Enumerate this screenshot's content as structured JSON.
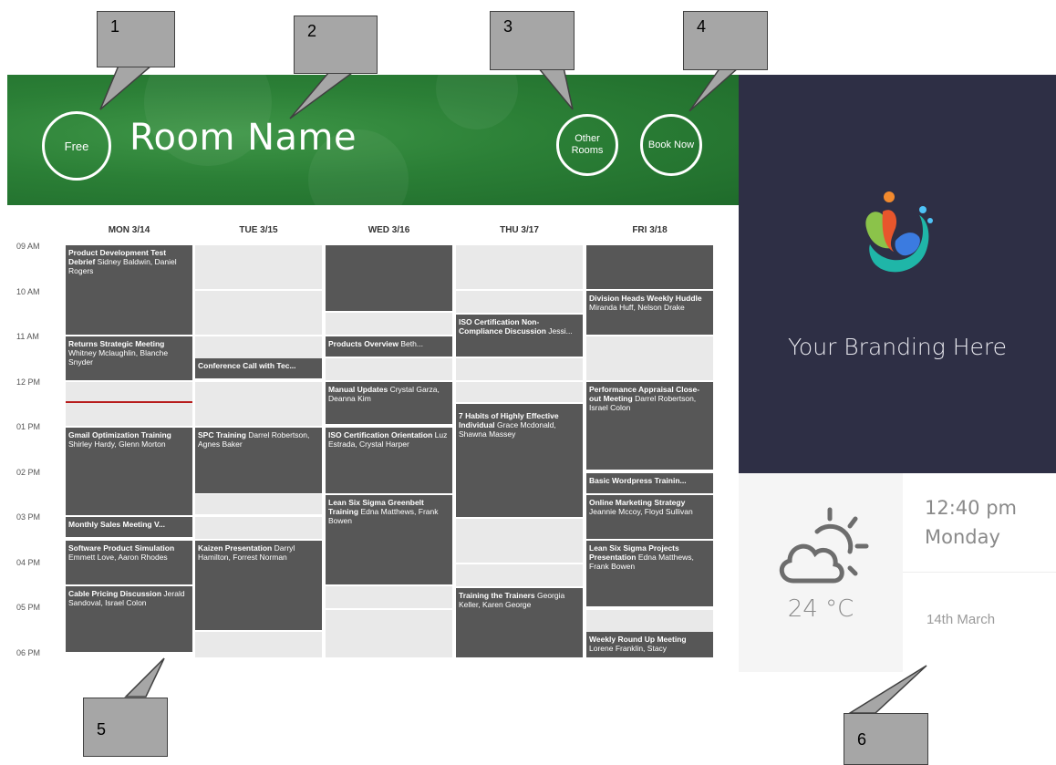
{
  "header": {
    "status_label": "Free",
    "room_name": "Room Name",
    "other_rooms_label": "Other Rooms",
    "book_now_label": "Book Now",
    "color": "#2b7f36"
  },
  "calendar": {
    "days": [
      "MON 3/14",
      "TUE 3/15",
      "WED 3/16",
      "THU 3/17",
      "FRI 3/18"
    ],
    "hours": [
      "09 AM",
      "10 AM",
      "11 AM",
      "12 PM",
      "01 PM",
      "02 PM",
      "03 PM",
      "04 PM",
      "05 PM",
      "06 PM"
    ],
    "events": {
      "mon": [
        {
          "title": "Product Development Test Debrief",
          "attendees": "Sidney Baldwin, Daniel Rogers"
        },
        {
          "title": "Returns Strategic Meeting",
          "attendees": "Whitney Mclaughlin, Blanche Snyder"
        },
        {
          "title": "Gmail Optimization Training",
          "attendees": "Shirley Hardy, Glenn Morton"
        },
        {
          "title": "Monthly Sales Meeting V...",
          "attendees": ""
        },
        {
          "title": "Software Product Simulation",
          "attendees": "Emmett Love, Aaron Rhodes"
        },
        {
          "title": "Cable Pricing Discussion",
          "attendees": "Jerald Sandoval, Israel Colon"
        }
      ],
      "tue": [
        {
          "title": "Conference Call with Tec...",
          "attendees": ""
        },
        {
          "title": "SPC Training",
          "attendees": "Darrel Robertson, Agnes Baker"
        },
        {
          "title": "Kaizen Presentation",
          "attendees": "Darryl Hamilton, Forrest Norman"
        }
      ],
      "wed": [
        {
          "title": "Products Overview",
          "attendees": "Beth..."
        },
        {
          "title": "Manual Updates",
          "attendees": "Crystal Garza, Deanna Kim"
        },
        {
          "title": "ISO Certification Orientation",
          "attendees": "Luz Estrada, Crystal Harper"
        },
        {
          "title": "Lean Six Sigma Greenbelt Training",
          "attendees": "Edna Matthews, Frank Bowen"
        }
      ],
      "thu": [
        {
          "title": "ISO Certification Non-Compliance Discussion",
          "attendees": "Jessi..."
        },
        {
          "title": "7 Habits of Highly Effective Individual",
          "attendees": "Grace Mcdonald, Shawna Massey"
        },
        {
          "title": "Training the Trainers",
          "attendees": "Georgia Keller, Karen George"
        }
      ],
      "fri": [
        {
          "title": "Division Heads Weekly Huddle",
          "attendees": "Miranda Huff, Nelson Drake"
        },
        {
          "title": "Performance Appraisal Close-out Meeting",
          "attendees": "Darrel Robertson, Israel Colon"
        },
        {
          "title": "Basic Wordpress Trainin...",
          "attendees": ""
        },
        {
          "title": "Online Marketing Strategy",
          "attendees": "Jeannie Mccoy, Floyd Sullivan"
        },
        {
          "title": "Lean Six Sigma Projects Presentation",
          "attendees": "Edna Matthews, Frank Bowen"
        },
        {
          "title": "Weekly Round Up Meeting",
          "attendees": "Lorene Franklin, Stacy"
        }
      ]
    }
  },
  "branding": {
    "text": "Your Branding Here"
  },
  "weather": {
    "temperature": "24 °C",
    "icon": "partly-cloudy-icon"
  },
  "clock": {
    "time": "12:40 pm",
    "day": "Monday",
    "date": "14th March"
  },
  "callouts": [
    "1",
    "2",
    "3",
    "4",
    "5",
    "6"
  ]
}
